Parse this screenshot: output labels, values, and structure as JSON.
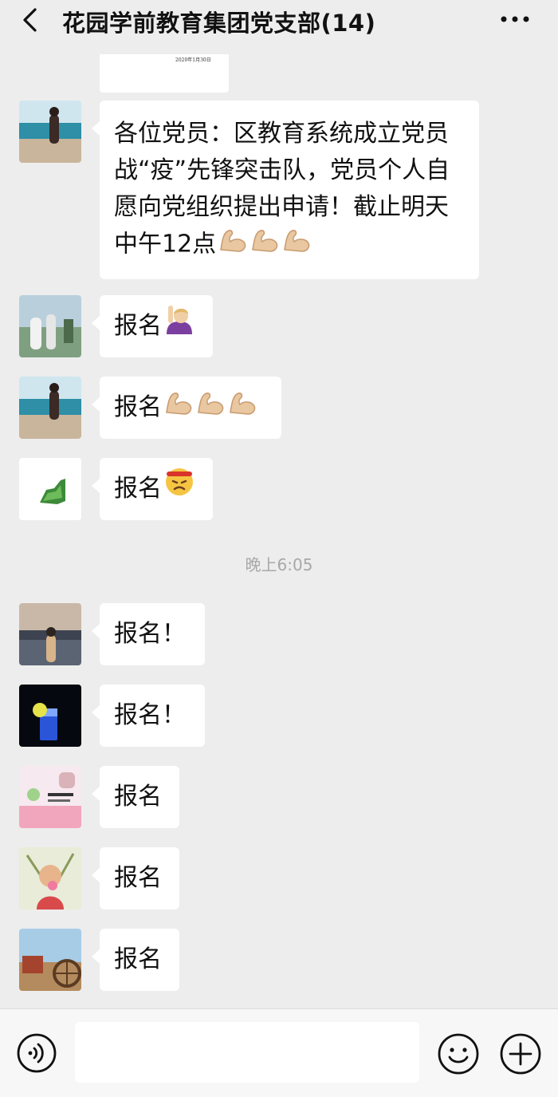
{
  "header": {
    "title": "花园学前教育集团党支部(14)",
    "back_icon": "chevron-left-icon",
    "more_icon": "more-dots-icon"
  },
  "top_image": {
    "caption": "2020年1月30日"
  },
  "messages": [
    {
      "text": "各位党员：区教育系统成立党员战“疫”先锋突击队，党员个人自愿向党组织提出申请！截止明天中午12点",
      "emoji": [
        "flexed-biceps-icon",
        "flexed-biceps-icon",
        "flexed-biceps-icon"
      ]
    },
    {
      "text": "报名",
      "emoji": [
        "raising-hand-icon"
      ]
    },
    {
      "text": "报名",
      "emoji": [
        "flexed-biceps-icon",
        "flexed-biceps-icon",
        "flexed-biceps-icon"
      ]
    },
    {
      "text": "报名",
      "emoji": [
        "determined-face-icon"
      ]
    },
    {
      "text": "报名！",
      "emoji": []
    },
    {
      "text": "报名！",
      "emoji": []
    },
    {
      "text": "报名",
      "emoji": []
    },
    {
      "text": "报名",
      "emoji": []
    },
    {
      "text": "报名",
      "emoji": []
    }
  ],
  "timestamp": "晚上6:05",
  "input": {
    "value": "",
    "placeholder": ""
  },
  "icons": {
    "voice": "voice-icon",
    "emoji": "emoji-smile-icon",
    "plus": "plus-circle-icon"
  },
  "colors": {
    "background": "#ededed",
    "bubble": "#ffffff",
    "timestamp": "#a8a8a8"
  }
}
